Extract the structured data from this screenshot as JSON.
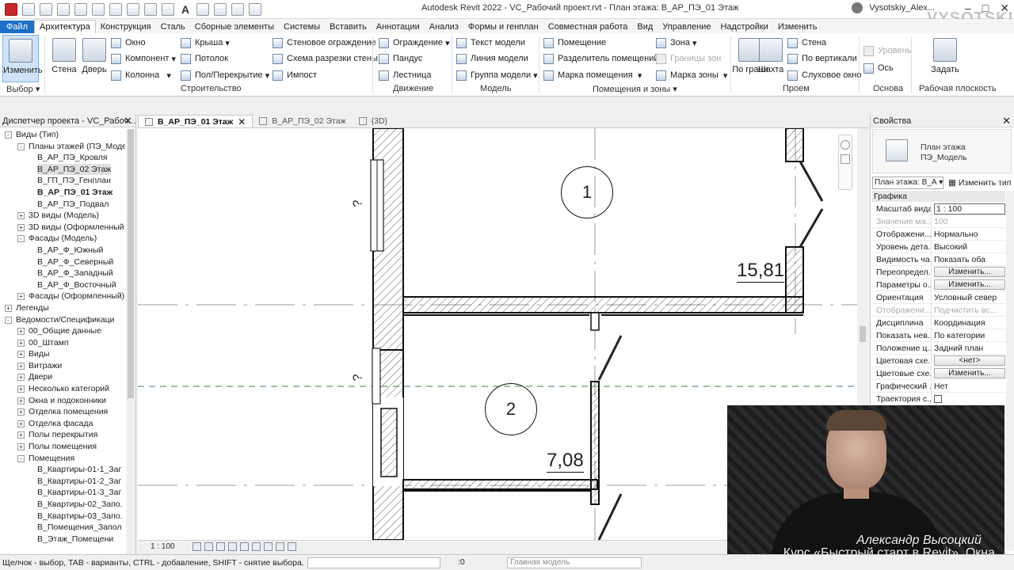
{
  "window": {
    "title": "Autodesk Revit 2022 - VC_Рабочий проект.rvt - План этажа: В_АР_ПЭ_01 Этаж",
    "user": "Vysotskiy_Alex..."
  },
  "ribbon_tabs": [
    "Файл",
    "Архитектура",
    "Конструкция",
    "Сталь",
    "Сборные элементы",
    "Системы",
    "Вставить",
    "Аннотации",
    "Анализ",
    "Формы и генплан",
    "Совместная работа",
    "Вид",
    "Управление",
    "Надстройки",
    "Изменить"
  ],
  "ribbon": {
    "modify": "Изменить",
    "select": "Выбор",
    "wall": "Стена",
    "door": "Дверь",
    "window": "Окно",
    "component": "Компонент",
    "column": "Колонна",
    "roof": "Крыша",
    "ceiling": "Потолок",
    "floor": "Пол/Перекрытие",
    "curtain_wall": "Стеновое ограждение",
    "curtain_grid": "Схема разрезки стены",
    "mullion": "Импост",
    "build_panel": "Строительство",
    "railing": "Ограждение",
    "ramp": "Пандус",
    "stair": "Лестница",
    "circulation_panel": "Движение",
    "model_text": "Текст модели",
    "model_line": "Линия модели",
    "model_group": "Группа модели",
    "model_panel": "Модель",
    "room": "Помещение",
    "room_separator": "Разделитель помещений",
    "room_tag": "Марка помещения",
    "area": "Зона",
    "area_boundary": "Границы зон",
    "area_tag": "Марка зоны",
    "room_area_panel": "Помещения и зоны",
    "by_face": "По грани",
    "shaft": "Шахта",
    "opening_wall": "Стена",
    "vertical": "По вертикали",
    "dormer": "Слуховое окно",
    "opening_panel": "Проем",
    "level": "Уровень",
    "grid": "Ось",
    "datum_panel": "Основа",
    "set": "Задать",
    "workplane_panel": "Рабочая плоскость"
  },
  "project_browser": {
    "title": "Диспетчер проекта - VC_Рабоч...",
    "tree": [
      {
        "label": "Виды (Тип)",
        "level": 0,
        "toggle": "-"
      },
      {
        "label": "Планы этажей (ПЭ_Моде",
        "level": 1,
        "toggle": "-"
      },
      {
        "label": "В_АР_ПЭ_Кровля",
        "level": 2,
        "toggle": ""
      },
      {
        "label": "В_АР_ПЭ_02 Этаж",
        "level": 2,
        "toggle": "",
        "selected": true
      },
      {
        "label": "В_ГП_ПЭ_Генплан",
        "level": 2,
        "toggle": ""
      },
      {
        "label": "В_АР_ПЭ_01 Этаж",
        "level": 2,
        "toggle": "",
        "bold": true
      },
      {
        "label": "В_АР_ПЭ_Подвал",
        "level": 2,
        "toggle": ""
      },
      {
        "label": "3D виды (Модель)",
        "level": 1,
        "toggle": "+"
      },
      {
        "label": "3D виды (Оформленный",
        "level": 1,
        "toggle": "+"
      },
      {
        "label": "Фасады (Модель)",
        "level": 1,
        "toggle": "-"
      },
      {
        "label": "В_АР_Ф_Южный",
        "level": 2,
        "toggle": ""
      },
      {
        "label": "В_АР_Ф_Северный",
        "level": 2,
        "toggle": ""
      },
      {
        "label": "В_АР_Ф_Западный",
        "level": 2,
        "toggle": ""
      },
      {
        "label": "В_АР_Ф_Восточный",
        "level": 2,
        "toggle": ""
      },
      {
        "label": "Фасады (Оформленный)",
        "level": 1,
        "toggle": "+"
      },
      {
        "label": "Легенды",
        "level": 0,
        "toggle": "+"
      },
      {
        "label": "Ведомости/Спецификаци",
        "level": 0,
        "toggle": "-"
      },
      {
        "label": "00_Общие данные",
        "level": 1,
        "toggle": "+"
      },
      {
        "label": "00_Штамп",
        "level": 1,
        "toggle": "+"
      },
      {
        "label": "Виды",
        "level": 1,
        "toggle": "+"
      },
      {
        "label": "Витражи",
        "level": 1,
        "toggle": "+"
      },
      {
        "label": "Двери",
        "level": 1,
        "toggle": "+"
      },
      {
        "label": "Несколько категорий",
        "level": 1,
        "toggle": "+"
      },
      {
        "label": "Окна и подоконники",
        "level": 1,
        "toggle": "+"
      },
      {
        "label": "Отделка помещения",
        "level": 1,
        "toggle": "+"
      },
      {
        "label": "Отделка фасада",
        "level": 1,
        "toggle": "+"
      },
      {
        "label": "Полы перекрытия",
        "level": 1,
        "toggle": "+"
      },
      {
        "label": "Полы помещения",
        "level": 1,
        "toggle": "+"
      },
      {
        "label": "Помещения",
        "level": 1,
        "toggle": "-"
      },
      {
        "label": "В_Квартиры-01-1_Заг",
        "level": 2,
        "toggle": ""
      },
      {
        "label": "В_Квартиры-01-2_Заг",
        "level": 2,
        "toggle": ""
      },
      {
        "label": "В_Квартиры-01-3_Заг",
        "level": 2,
        "toggle": ""
      },
      {
        "label": "В_Квартиры-02_Запо.",
        "level": 2,
        "toggle": ""
      },
      {
        "label": "В_Квартиры-03_Запо.",
        "level": 2,
        "toggle": ""
      },
      {
        "label": "В_Помещения_Запол",
        "level": 2,
        "toggle": ""
      },
      {
        "label": "В_Этаж_Помещени",
        "level": 2,
        "toggle": ""
      }
    ]
  },
  "view_tabs": [
    {
      "label": "В_АР_ПЭ_01 Этаж",
      "active": true
    },
    {
      "label": "В_АР_ПЭ_02 Этаж",
      "active": false
    },
    {
      "label": "{3D}",
      "active": false
    }
  ],
  "drawing": {
    "room1_number": "1",
    "room1_area": "15,81",
    "room2_number": "2",
    "room2_area": "7,08",
    "door_tag": "?"
  },
  "view_control": {
    "scale": "1 : 100"
  },
  "properties": {
    "title": "Свойства",
    "type_line1": "План этажа",
    "type_line2": "ПЭ_Модель",
    "filter": "План этажа: В_А",
    "edit_type": "Изменить тип",
    "group": "Графика",
    "rows": [
      {
        "name": "Масштаб вида",
        "value": "1 : 100",
        "kind": "input"
      },
      {
        "name": "Значение ма...",
        "value": "100",
        "kind": "disabled"
      },
      {
        "name": "Отображени...",
        "value": "Нормально",
        "kind": "text"
      },
      {
        "name": "Уровень дета...",
        "value": "Высокий",
        "kind": "text"
      },
      {
        "name": "Видимость ча...",
        "value": "Показать оба",
        "kind": "text"
      },
      {
        "name": "Переопредел...",
        "value": "Изменить...",
        "kind": "button"
      },
      {
        "name": "Параметры о...",
        "value": "Изменить...",
        "kind": "button"
      },
      {
        "name": "Ориентация",
        "value": "Условный север",
        "kind": "text"
      },
      {
        "name": "Отображени...",
        "value": "Подчистить вс...",
        "kind": "disabled"
      },
      {
        "name": "Дисциплина",
        "value": "Координация",
        "kind": "text"
      },
      {
        "name": "Показать нев...",
        "value": "По категории",
        "kind": "text"
      },
      {
        "name": "Положение ц...",
        "value": "Задний план",
        "kind": "text"
      },
      {
        "name": "Цветовая схе...",
        "value": "<нет>",
        "kind": "button"
      },
      {
        "name": "Цветовые схе...",
        "value": "Изменить...",
        "kind": "button"
      },
      {
        "name": "Графический ...",
        "value": "Нет",
        "kind": "text"
      },
      {
        "name": "Траектория с...",
        "value": "",
        "kind": "checkbox"
      }
    ]
  },
  "webcam": {
    "caption_name": "Александр Высоцкий",
    "caption_course": "Курс «Быстрый старт в Revit». Окна"
  },
  "status": {
    "hint": "Щелчок - выбор, TAB - варианты, CTRL - добавление, SHIFT - снятие выбора.",
    "counter": ":0",
    "model": "Главная модель"
  },
  "watermark": "VYSOTSKIY"
}
